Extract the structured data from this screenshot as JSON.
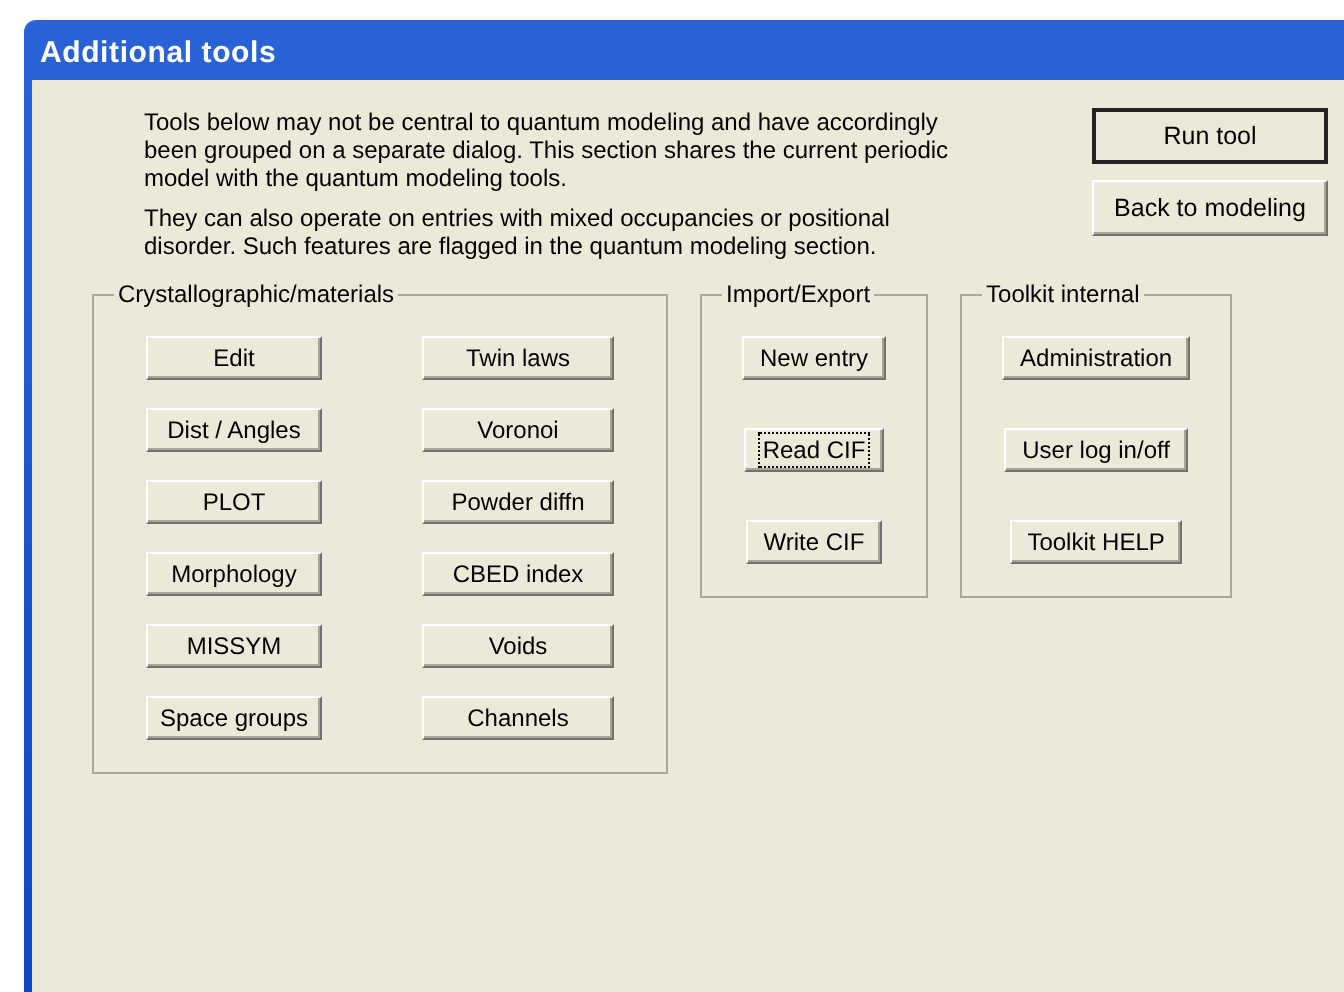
{
  "window": {
    "title": "Additional tools"
  },
  "intro": [
    "Tools below may not be central to quantum modeling and have accordingly been grouped on a separate dialog. This section shares the current periodic model with the quantum modeling tools.",
    "They can also operate on entries with mixed occupancies or positional disorder. Such features are flagged in the quantum modeling section."
  ],
  "actions": [
    {
      "label": "Run tool",
      "default": true
    },
    {
      "label": "Back to modeling",
      "default": false
    }
  ],
  "groups": [
    {
      "title": "Crystallographic/materials",
      "buttons": [
        {
          "label": "Edit",
          "focused": false
        },
        {
          "label": "Twin laws",
          "focused": false
        },
        {
          "label": "Dist / Angles",
          "focused": false
        },
        {
          "label": "Voronoi",
          "focused": false
        },
        {
          "label": "PLOT",
          "focused": false
        },
        {
          "label": "Powder diffn",
          "focused": false
        },
        {
          "label": "Morphology",
          "focused": false
        },
        {
          "label": "CBED index",
          "focused": false
        },
        {
          "label": "MISSYM",
          "focused": false
        },
        {
          "label": "Voids",
          "focused": false
        },
        {
          "label": "Space groups",
          "focused": false
        },
        {
          "label": "Channels",
          "focused": false
        }
      ]
    },
    {
      "title": "Import/Export",
      "buttons": [
        {
          "label": "New entry",
          "focused": false
        },
        {
          "label": "Read CIF",
          "focused": true
        },
        {
          "label": "Write CIF",
          "focused": false
        }
      ]
    },
    {
      "title": "Toolkit internal",
      "buttons": [
        {
          "label": "Administration",
          "focused": false
        },
        {
          "label": "User log in/off",
          "focused": false
        },
        {
          "label": "Toolkit HELP",
          "focused": false
        }
      ]
    }
  ]
}
